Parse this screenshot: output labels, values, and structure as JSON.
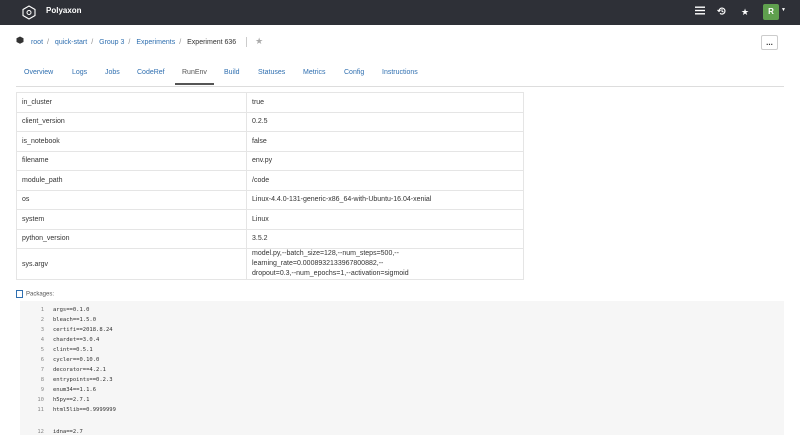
{
  "app": {
    "brand": "Polyaxon"
  },
  "topbar": {
    "avatar_letter": "R",
    "icons": [
      "menu-icon",
      "history-icon",
      "star-icon"
    ]
  },
  "breadcrumb": [
    "root",
    "quick-start",
    "Group 3",
    "Experiments",
    "Experiment 636"
  ],
  "more_button": "...",
  "tabs": [
    "Overview",
    "Logs",
    "Jobs",
    "CodeRef",
    "RunEnv",
    "Build",
    "Statuses",
    "Metrics",
    "Config",
    "Instructions"
  ],
  "active_tab": "RunEnv",
  "env_rows": [
    {
      "key": "in_cluster",
      "value": "true"
    },
    {
      "key": "client_version",
      "value": "0.2.5"
    },
    {
      "key": "is_notebook",
      "value": "false"
    },
    {
      "key": "filename",
      "value": "env.py"
    },
    {
      "key": "module_path",
      "value": "/code"
    },
    {
      "key": "os",
      "value": "Linux-4.4.0-131-generic-x86_64-with-Ubuntu-16.04-xenial"
    },
    {
      "key": "system",
      "value": "Linux"
    },
    {
      "key": "python_version",
      "value": "3.5.2"
    },
    {
      "key": "sys.argv",
      "value_lines": [
        "model.py,--batch_size=128,--num_steps=500,--learning_rate=0.0008932133967800882,--",
        "dropout=0.3,--num_epochs=1,--activation=sigmoid"
      ]
    }
  ],
  "packages_label": "Packages:",
  "packages": [
    "args==0.1.0",
    "bleach==1.5.0",
    "certifi==2018.8.24",
    "chardet==3.0.4",
    "clint==0.5.1",
    "cycler==0.10.0",
    "decorator==4.2.1",
    "entrypoints==0.2.3",
    "enum34==1.1.6",
    "h5py==2.7.1",
    "html5lib==0.9999999",
    "idna==2.7"
  ]
}
